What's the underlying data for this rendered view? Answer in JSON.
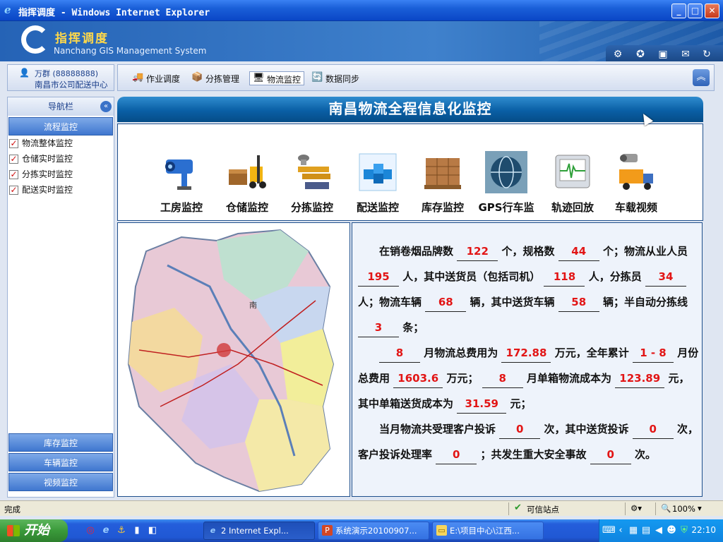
{
  "window": {
    "title": "指挥调度 - Windows Internet Explorer",
    "minimize": "_",
    "maximize": "□",
    "close": "✕"
  },
  "header": {
    "app_name": "指挥调度",
    "subtitle": "Nanchang GIS Management System",
    "icons": [
      "gear-icon",
      "star-icon",
      "image-icon",
      "mail-icon",
      "refresh-icon"
    ]
  },
  "user": {
    "name": "万群 (88888888)",
    "org": "南昌市公司配送中心"
  },
  "tabs": [
    {
      "label": "作业调度",
      "icon": "truck-icon",
      "active": false
    },
    {
      "label": "分拣管理",
      "icon": "box-icon",
      "active": false
    },
    {
      "label": "物流监控",
      "icon": "monitor-icon",
      "active": true
    },
    {
      "label": "数据同步",
      "icon": "sync-icon",
      "active": false
    }
  ],
  "sidebar": {
    "title": "导航栏",
    "sections": [
      {
        "label": "流程监控"
      },
      {
        "label": "库存监控"
      },
      {
        "label": "车辆监控"
      },
      {
        "label": "视频监控"
      }
    ],
    "items": [
      {
        "label": "物流整体监控",
        "checked": true
      },
      {
        "label": "仓储实时监控",
        "checked": true
      },
      {
        "label": "分拣实时监控",
        "checked": true
      },
      {
        "label": "配送实时监控",
        "checked": true
      }
    ]
  },
  "main": {
    "title": "南昌物流全程信息化监控",
    "monitors": [
      {
        "label": "工房监控",
        "icon": "camera-icon"
      },
      {
        "label": "仓储监控",
        "icon": "forklift-icon"
      },
      {
        "label": "分拣监控",
        "icon": "sorting-icon"
      },
      {
        "label": "配送监控",
        "icon": "cubes-icon"
      },
      {
        "label": "库存监控",
        "icon": "pallet-icon"
      },
      {
        "label": "GPS行车监",
        "icon": "globe-icon"
      },
      {
        "label": "轨迹回放",
        "icon": "oscilloscope-icon"
      },
      {
        "label": "车载视频",
        "icon": "truck-camera-icon"
      }
    ],
    "map_label": "南",
    "info": {
      "brands": "122",
      "specs": "44",
      "staff": "195",
      "drivers": "118",
      "sorters": "34",
      "vehicles": "68",
      "delivery_vehicles": "58",
      "sort_lines": "3",
      "month": "8",
      "month_cost": "172.88",
      "ytd_range": "1 - 8",
      "ytd_cost": "1603.6",
      "month2": "8",
      "unit_cost": "123.89",
      "unit_delivery_cost": "31.59",
      "complaints": "0",
      "delivery_complaints": "0",
      "resolve_rate": "0",
      "accidents": "0",
      "t": {
        "p1a": "在销卷烟品牌数",
        "p1b": "个，规格数",
        "p1c": "个；物流从业人员",
        "p1d": "人，其中送货员（包括司机）",
        "p1e": "人，分拣员",
        "p1f": "人；物流车辆",
        "p1g": "辆，其中送货车辆",
        "p1h": "辆；半自动分拣线",
        "p1i": "条；",
        "p2a": "月物流总费用为",
        "p2b": "万元，全年累计",
        "p2c": "月份总费用",
        "p2d": "万元；",
        "p2e": "月单箱物流成本为",
        "p2f": "元，其中单箱送货成本为",
        "p2g": "元；",
        "p3a": "当月物流共受理客户投诉",
        "p3b": "次，其中送货投诉",
        "p3c": "次，客户投诉处理率",
        "p3d": "；共发生重大安全事故",
        "p3e": "次。"
      }
    }
  },
  "statusbar": {
    "status": "完成",
    "zone": "可信站点",
    "zoom": "100%"
  },
  "taskbar": {
    "start": "开始",
    "buttons": [
      {
        "label": "2 Internet Expl...",
        "active": true
      },
      {
        "label": "系统演示20100907...",
        "active": false
      },
      {
        "label": "E:\\项目中心\\江西...",
        "active": false
      }
    ],
    "clock": "22:10"
  },
  "colors": {
    "accent": "#2058d4",
    "highlight_value": "#e21515",
    "banner": "#0a5fa5"
  }
}
